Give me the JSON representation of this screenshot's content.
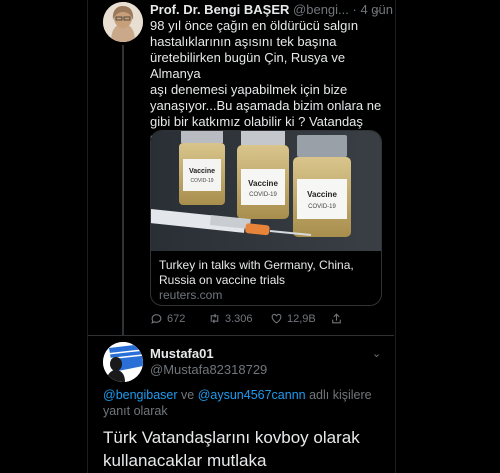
{
  "tweet": {
    "author_name": "Prof. Dr. Bengi BAŞER",
    "author_handle": "@bengi...",
    "time": "· 4 gün",
    "text": "98 yıl önce çağın en öldürücü salgın\nhastalıklarının aşısını tek başına\nüretebilirken bugün Çin, Rusya ve Almanya\naşı denemesi yapabilmek için bize\nyanaşıyor...Bu aşamada bizim onlara ne\ngibi bir katkımız olabilir ki ? Vatandaş\nolarak çok rahatsız oldum..",
    "card": {
      "vial_label": "Vaccine",
      "vial_sublabel": "COVID-19",
      "title": "Turkey in talks with Germany, China,\nRussia on vaccine trials",
      "domain": "reuters.com"
    },
    "actions": {
      "replies": "672",
      "retweets": "3.306",
      "likes": "12,9B"
    }
  },
  "reply": {
    "author_name": "Mustafa01",
    "author_handle": "@Mustafa82318729",
    "mention1": "@bengibaser",
    "connector": " ve ",
    "mention2": "@aysun4567cannn",
    "reply_suffix": " adlı kişilere yanıt olarak",
    "text": "Türk Vatandaşlarını kovboy olarak\nkullanacaklar mutlaka"
  },
  "colors": {
    "background": "#000000",
    "text": "#e7e9ea",
    "muted": "#71767b",
    "link": "#1d9bf0",
    "border": "#2f3336"
  }
}
